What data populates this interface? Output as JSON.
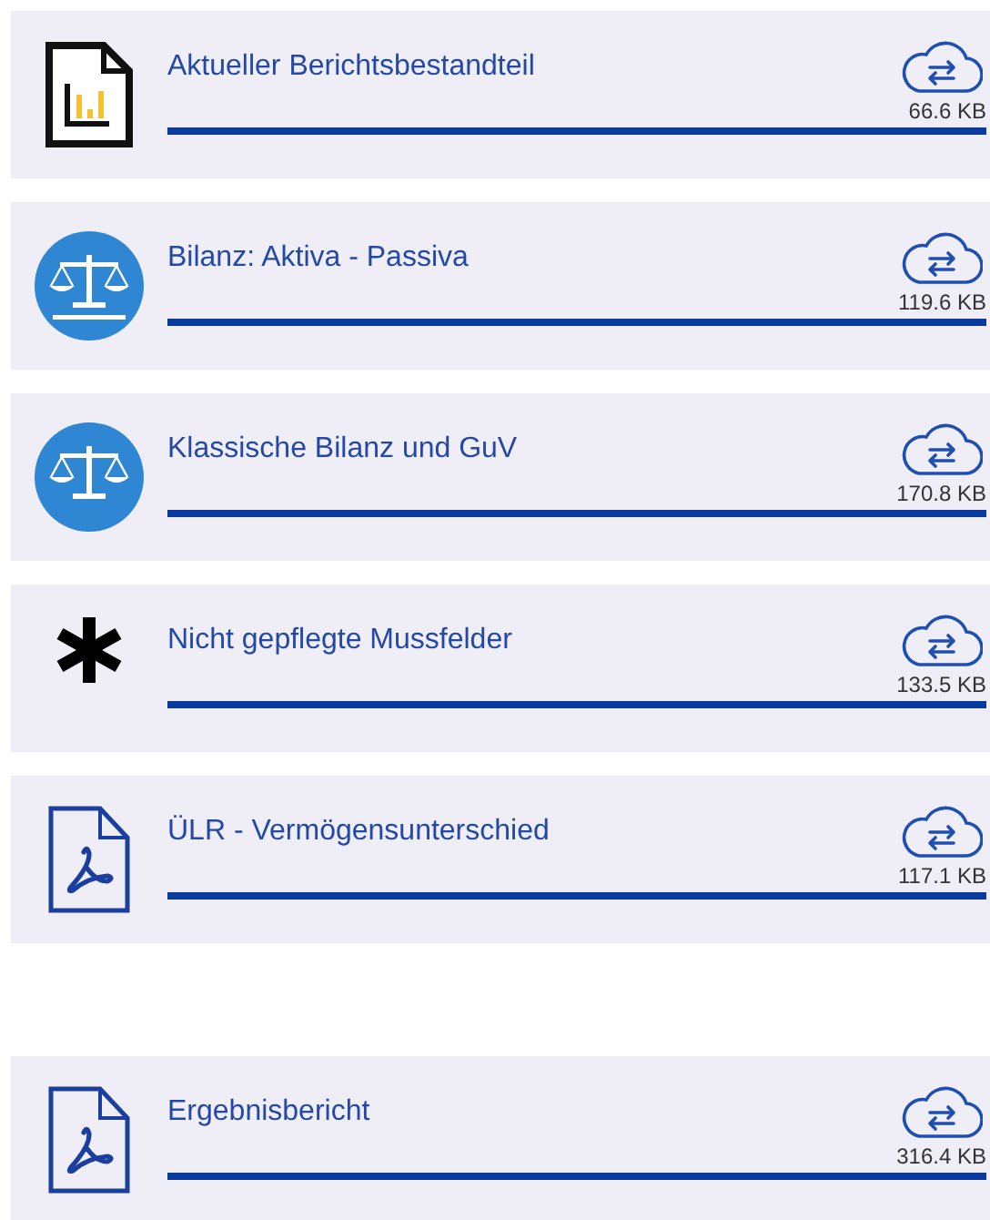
{
  "sections": [
    {
      "items": [
        {
          "kind": "report",
          "title": "Aktueller Berichtsbestandteil",
          "size": "66.6 KB",
          "level": 1
        },
        {
          "kind": "balance",
          "title": "Bilanz: Aktiva - Passiva",
          "size": "119.6 KB",
          "level": 1
        },
        {
          "kind": "balance",
          "title": "Klassische Bilanz und GuV",
          "size": "170.8 KB",
          "level": 1
        },
        {
          "kind": "asterisk",
          "title": "Nicht gepflegte Mussfelder",
          "size": "133.5 KB",
          "level": 1
        },
        {
          "kind": "pdf",
          "title": "ÜLR - Vermögensunterschied",
          "size": "117.1 KB",
          "level": 1
        }
      ]
    },
    {
      "items": [
        {
          "kind": "pdf",
          "title": "Ergebnisbericht",
          "size": "316.4 KB",
          "level": 1
        }
      ]
    }
  ]
}
